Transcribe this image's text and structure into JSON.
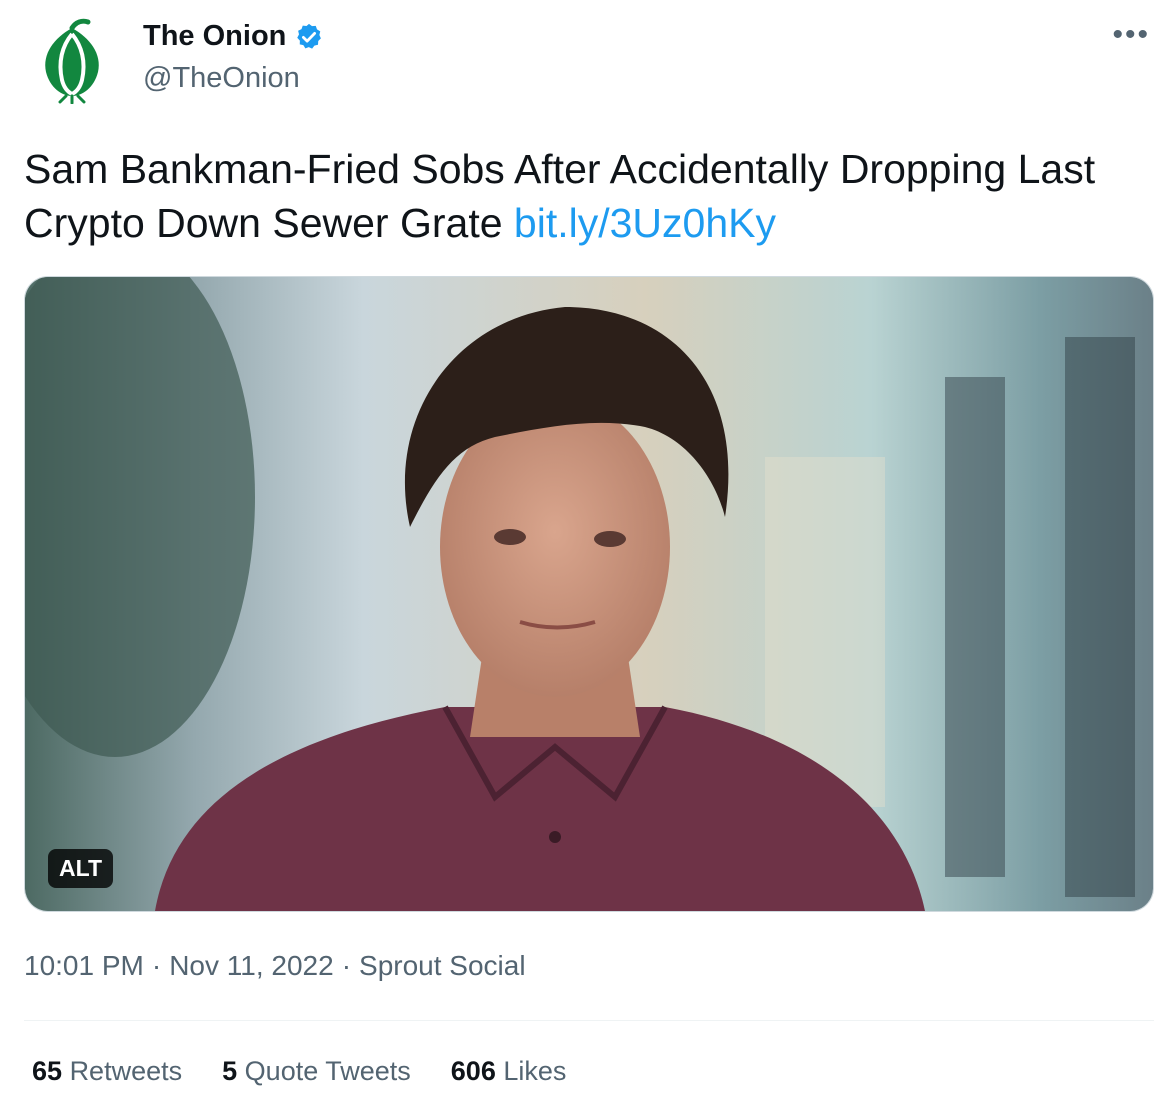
{
  "author": {
    "display_name": "The Onion",
    "handle": "@TheOnion",
    "verified": true,
    "brand_color": "#12873f",
    "verified_color": "#1d9bf0"
  },
  "tweet": {
    "text": "Sam Bankman-Fried Sobs After Accidentally Dropping Last Crypto Down Sewer Grate",
    "link": "bit.ly/3Uz0hKy",
    "link_color": "#1d9bf0"
  },
  "media": {
    "alt_badge": "ALT"
  },
  "meta": {
    "time": "10:01 PM",
    "date": "Nov 11, 2022",
    "source": "Sprout Social",
    "separator": "·"
  },
  "stats": {
    "retweets_count": "65",
    "retweets_label": "Retweets",
    "quotes_count": "5",
    "quotes_label": "Quote Tweets",
    "likes_count": "606",
    "likes_label": "Likes"
  },
  "more_icon": "more-horizontal-icon"
}
